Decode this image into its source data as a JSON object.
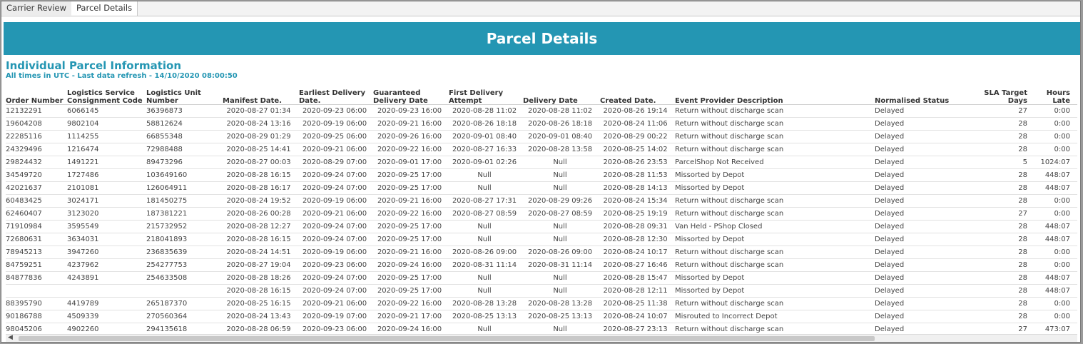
{
  "tabs": [
    {
      "label": "Carrier Review",
      "active": false
    },
    {
      "label": "Parcel Details",
      "active": true
    }
  ],
  "banner": {
    "title": "Parcel Details"
  },
  "section": {
    "title": "Individual Parcel Information",
    "subtitle": "All times in UTC - Last data refresh - 14/10/2020 08:00:50"
  },
  "columns": [
    {
      "line1": "",
      "line2": "Order Number"
    },
    {
      "line1": "Logistics Service",
      "line2": "Consignment Code"
    },
    {
      "line1": "Logistics Unit",
      "line2": "Number"
    },
    {
      "line1": "",
      "line2": "Manifest Date."
    },
    {
      "line1": "Earliest Delivery",
      "line2": "Date."
    },
    {
      "line1": "Guaranteed",
      "line2": "Delivery Date"
    },
    {
      "line1": "First Delivery",
      "line2": "Attempt"
    },
    {
      "line1": "",
      "line2": "Delivery Date"
    },
    {
      "line1": "",
      "line2": "Created Date."
    },
    {
      "line1": "",
      "line2": "Event Provider Description"
    },
    {
      "line1": "",
      "line2": "Normalised Status"
    },
    {
      "line1": "SLA Target",
      "line2": "Days"
    },
    {
      "line1": "Hours",
      "line2": "Late"
    }
  ],
  "rows": [
    [
      "12132291",
      "6066145",
      "36396873",
      "2020-08-27 01:34",
      "2020-09-23 06:00",
      "2020-09-23 16:00",
      "2020-08-28 11:02",
      "2020-08-28 11:02",
      "2020-08-26 19:14",
      "Return without discharge scan",
      "Delayed",
      "27",
      "0:00"
    ],
    [
      "19604208",
      "9802104",
      "58812624",
      "2020-08-24 13:16",
      "2020-09-19 06:00",
      "2020-09-21 16:00",
      "2020-08-26 18:18",
      "2020-08-26 18:18",
      "2020-08-24 11:06",
      "Return without discharge scan",
      "Delayed",
      "28",
      "0:00"
    ],
    [
      "22285116",
      "1114255",
      "66855348",
      "2020-08-29 01:29",
      "2020-09-25 06:00",
      "2020-09-26 16:00",
      "2020-09-01 08:40",
      "2020-09-01 08:40",
      "2020-08-29 00:22",
      "Return without discharge scan",
      "Delayed",
      "28",
      "0:00"
    ],
    [
      "24329496",
      "1216474",
      "72988488",
      "2020-08-25 14:41",
      "2020-09-21 06:00",
      "2020-09-22 16:00",
      "2020-08-27 16:33",
      "2020-08-28 13:58",
      "2020-08-25 14:02",
      "Return without discharge scan",
      "Delayed",
      "28",
      "0:00"
    ],
    [
      "29824432",
      "1491221",
      "89473296",
      "2020-08-27 00:03",
      "2020-08-29 07:00",
      "2020-09-01 17:00",
      "2020-09-01 02:26",
      "Null",
      "2020-08-26 23:53",
      "ParcelShop Not Received",
      "Delayed",
      "5",
      "1024:07"
    ],
    [
      "34549720",
      "1727486",
      "103649160",
      "2020-08-28 16:15",
      "2020-09-24 07:00",
      "2020-09-25 17:00",
      "Null",
      "Null",
      "2020-08-28 11:53",
      "Missorted by Depot",
      "Delayed",
      "28",
      "448:07"
    ],
    [
      "42021637",
      "2101081",
      "126064911",
      "2020-08-28 16:17",
      "2020-09-24 07:00",
      "2020-09-25 17:00",
      "Null",
      "Null",
      "2020-08-28 14:13",
      "Missorted by Depot",
      "Delayed",
      "28",
      "448:07"
    ],
    [
      "60483425",
      "3024171",
      "181450275",
      "2020-08-24 19:52",
      "2020-09-19 06:00",
      "2020-09-21 16:00",
      "2020-08-27 17:31",
      "2020-08-29 09:26",
      "2020-08-24 15:34",
      "Return without discharge scan",
      "Delayed",
      "28",
      "0:00"
    ],
    [
      "62460407",
      "3123020",
      "187381221",
      "2020-08-26 00:28",
      "2020-09-21 06:00",
      "2020-09-22 16:00",
      "2020-08-27 08:59",
      "2020-08-27 08:59",
      "2020-08-25 19:19",
      "Return without discharge scan",
      "Delayed",
      "27",
      "0:00"
    ],
    [
      "71910984",
      "3595549",
      "215732952",
      "2020-08-28 12:27",
      "2020-09-24 07:00",
      "2020-09-25 17:00",
      "Null",
      "Null",
      "2020-08-28 09:31",
      "Van Held - PShop Closed",
      "Delayed",
      "28",
      "448:07"
    ],
    [
      "72680631",
      "3634031",
      "218041893",
      "2020-08-28 16:15",
      "2020-09-24 07:00",
      "2020-09-25 17:00",
      "Null",
      "Null",
      "2020-08-28 12:30",
      "Missorted by Depot",
      "Delayed",
      "28",
      "448:07"
    ],
    [
      "78945213",
      "3947260",
      "236835639",
      "2020-08-24 14:51",
      "2020-09-19 06:00",
      "2020-09-21 16:00",
      "2020-08-26 09:00",
      "2020-08-26 09:00",
      "2020-08-24 10:17",
      "Return without discharge scan",
      "Delayed",
      "28",
      "0:00"
    ],
    [
      "84759251",
      "4237962",
      "254277753",
      "2020-08-27 19:04",
      "2020-09-23 06:00",
      "2020-09-24 16:00",
      "2020-08-31 11:14",
      "2020-08-31 11:14",
      "2020-08-27 16:46",
      "Return without discharge scan",
      "Delayed",
      "28",
      "0:00"
    ],
    [
      "84877836",
      "4243891",
      "254633508",
      "2020-08-28 18:26",
      "2020-09-24 07:00",
      "2020-09-25 17:00",
      "Null",
      "Null",
      "2020-08-28 15:47",
      "Missorted by Depot",
      "Delayed",
      "28",
      "448:07"
    ],
    [
      "",
      "",
      "",
      "2020-08-28 16:15",
      "2020-09-24 07:00",
      "2020-09-25 17:00",
      "Null",
      "Null",
      "2020-08-28 12:11",
      "Missorted by Depot",
      "Delayed",
      "28",
      "448:07"
    ],
    [
      "88395790",
      "4419789",
      "265187370",
      "2020-08-25 16:15",
      "2020-09-21 06:00",
      "2020-09-22 16:00",
      "2020-08-28 13:28",
      "2020-08-28 13:28",
      "2020-08-25 11:38",
      "Return without discharge scan",
      "Delayed",
      "28",
      "0:00"
    ],
    [
      "90186788",
      "4509339",
      "270560364",
      "2020-08-24 13:43",
      "2020-09-19 07:00",
      "2020-09-21 17:00",
      "2020-08-25 13:13",
      "2020-08-25 13:13",
      "2020-08-24 10:07",
      "Misrouted to Incorrect Depot",
      "Delayed",
      "28",
      "0:00"
    ],
    [
      "98045206",
      "4902260",
      "294135618",
      "2020-08-28 06:59",
      "2020-09-23 06:00",
      "2020-09-24 16:00",
      "Null",
      "Null",
      "2020-08-27 23:13",
      "Return without discharge scan",
      "Delayed",
      "27",
      "473:07"
    ]
  ]
}
